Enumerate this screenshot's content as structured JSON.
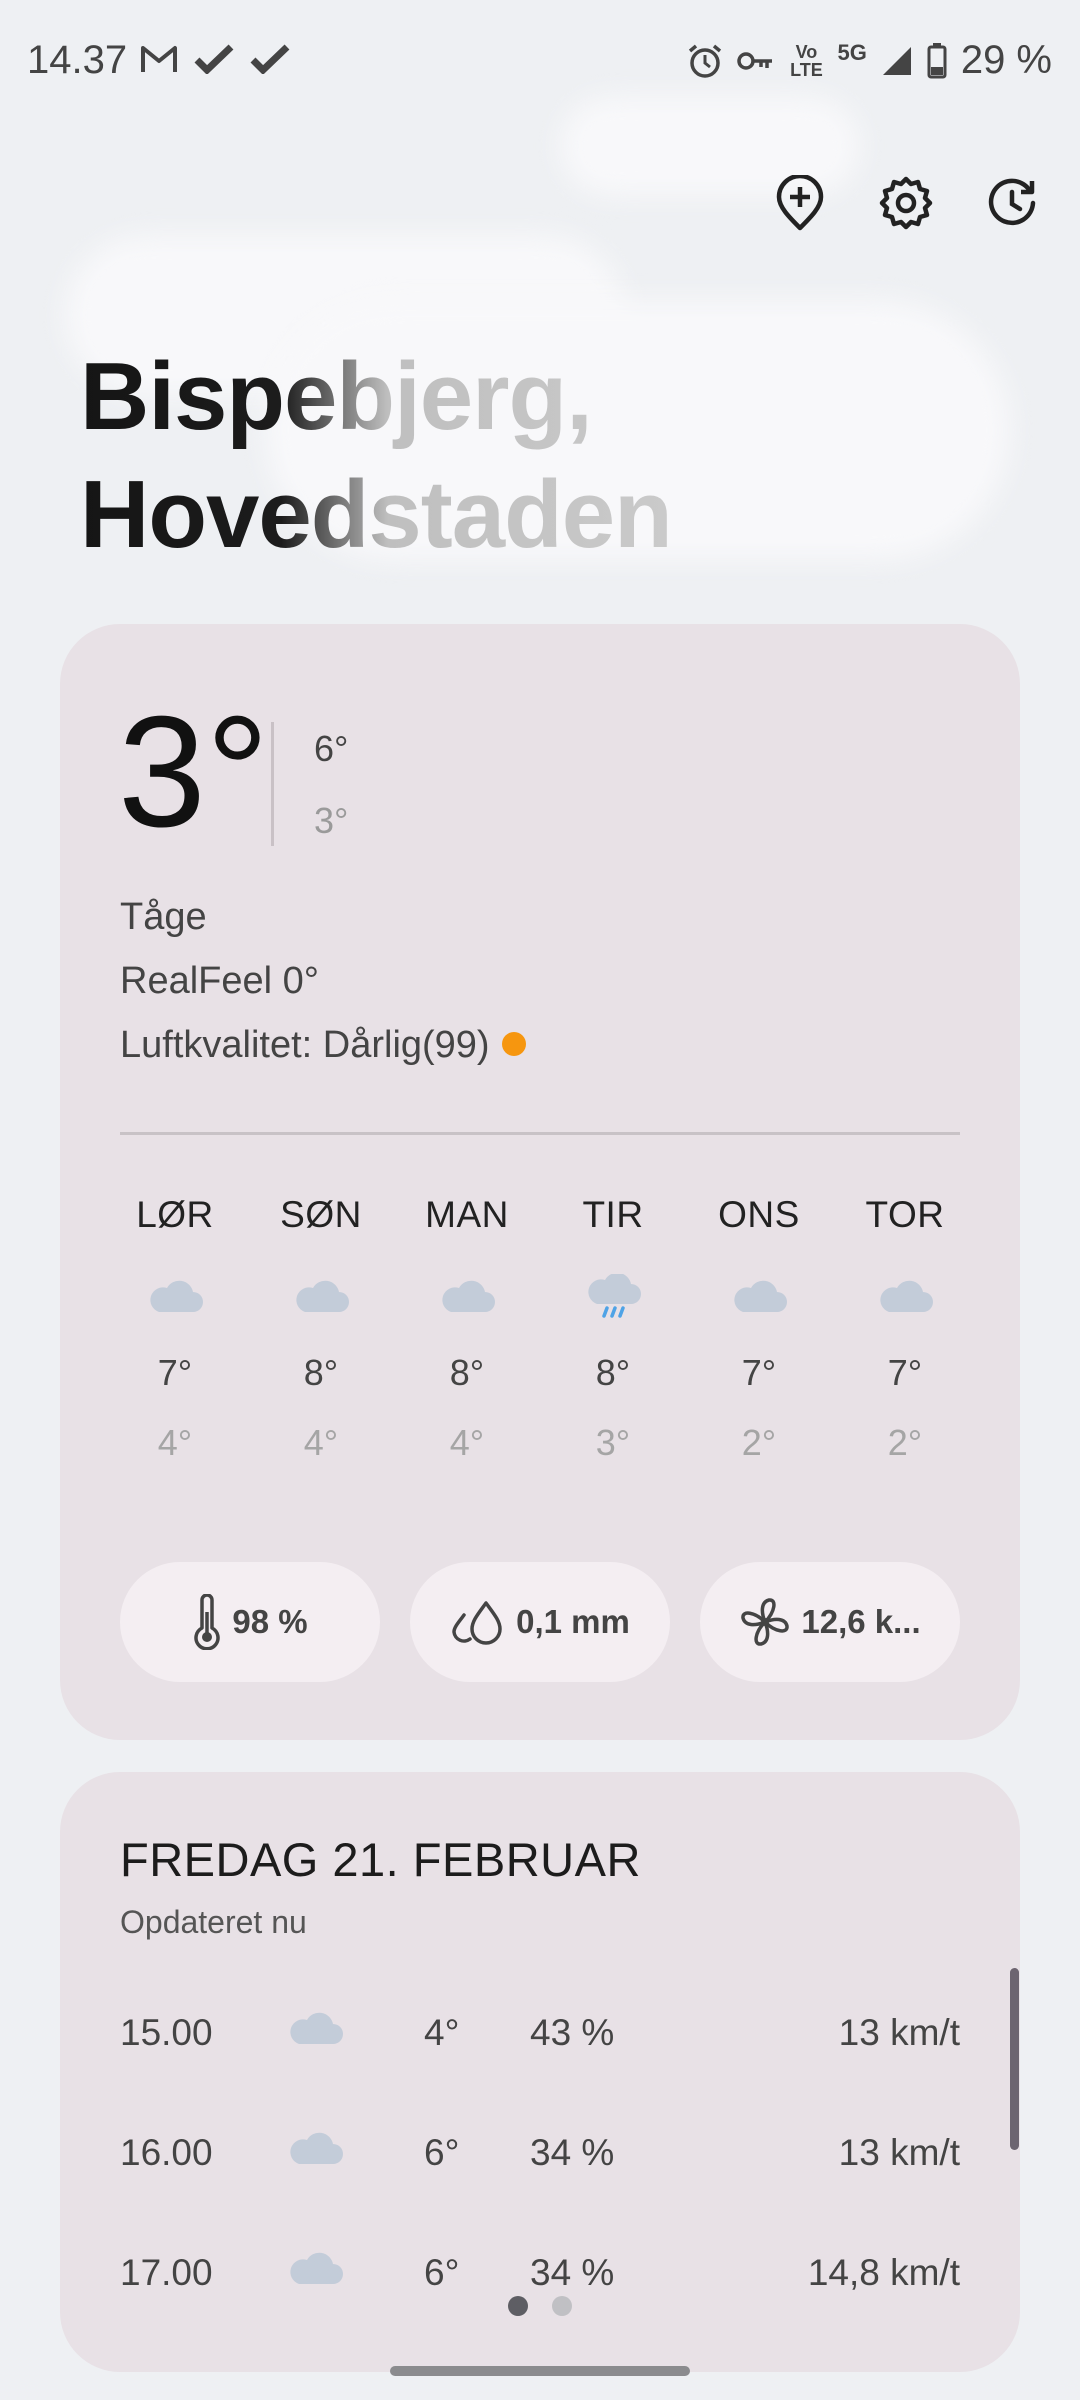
{
  "status_bar": {
    "time": "14.37",
    "left_icons": [
      "gmail-icon",
      "check-icon",
      "check-icon"
    ],
    "right_icons": [
      "alarm-icon",
      "vpn-key-icon",
      "volte-icon",
      "5g-icon",
      "signal-icon",
      "battery-icon"
    ],
    "volte_label": "Vo LTE",
    "network_label": "5G",
    "battery": "29 %"
  },
  "toolbar": {
    "add_location": "add-location-icon",
    "settings": "settings-icon",
    "history": "history-icon"
  },
  "location": {
    "line1": "Bispebjerg,",
    "line2": "Hovedstaden"
  },
  "current": {
    "temp": "3°",
    "high": "6°",
    "low": "3°",
    "condition": "Tåge",
    "realfeel": "RealFeel 0°",
    "air_quality": "Luftkvalitet: Dårlig(99)",
    "air_quality_color": "#f6960f"
  },
  "forecast": [
    {
      "day": "LØR",
      "icon": "cloud-icon",
      "high": "7°",
      "low": "4°"
    },
    {
      "day": "SØN",
      "icon": "cloud-icon",
      "high": "8°",
      "low": "4°"
    },
    {
      "day": "MAN",
      "icon": "cloud-icon",
      "high": "8°",
      "low": "4°"
    },
    {
      "day": "TIR",
      "icon": "rain-cloud-icon",
      "high": "8°",
      "low": "3°"
    },
    {
      "day": "ONS",
      "icon": "cloud-icon",
      "high": "7°",
      "low": "2°"
    },
    {
      "day": "TOR",
      "icon": "cloud-icon",
      "high": "7°",
      "low": "2°"
    }
  ],
  "stats": {
    "humidity": "98 %",
    "precipitation": "0,1 mm",
    "wind": "12,6 k..."
  },
  "hourly": {
    "date": "FREDAG 21. FEBRUAR",
    "updated": "Opdateret nu",
    "rows": [
      {
        "time": "15.00",
        "icon": "cloud-icon",
        "temp": "4°",
        "pct": "43 %",
        "wind": "13 km/t"
      },
      {
        "time": "16.00",
        "icon": "cloud-icon",
        "temp": "6°",
        "pct": "34 %",
        "wind": "13 km/t"
      },
      {
        "time": "17.00",
        "icon": "cloud-icon",
        "temp": "6°",
        "pct": "34 %",
        "wind": "14,8 km/t"
      }
    ]
  },
  "pager": {
    "pages": 2,
    "active": 1
  },
  "colors": {
    "card_bg": "#e8e1e6",
    "pill_bg": "#f4eef2",
    "cloud": "#c3ccd9",
    "rain": "#4fa3e6"
  }
}
